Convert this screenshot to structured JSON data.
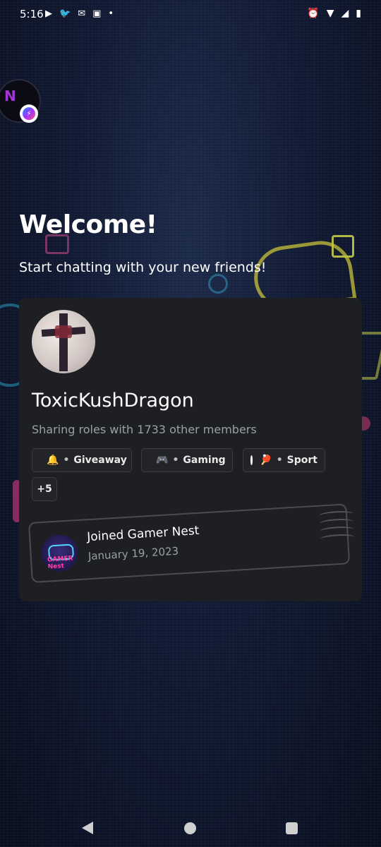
{
  "status_bar": {
    "time": "5:16",
    "left_icons": [
      "youtube-icon",
      "twitter-icon",
      "outlook-icon",
      "twitch-icon",
      "dot-icon"
    ],
    "right_icons": [
      "alarm-icon",
      "wifi-icon",
      "signal-icon",
      "battery-icon"
    ]
  },
  "chat_head": {
    "letter": "N"
  },
  "welcome": {
    "title": "Welcome!",
    "subtitle": "Start chatting with your new friends!"
  },
  "profile": {
    "username": "ToxicKushDragon",
    "sharing_text": "Sharing roles with 1733 other members",
    "roles": [
      {
        "emoji": "🔔",
        "label": "Giveaway"
      },
      {
        "emoji": "🎮",
        "label": "Gaming"
      },
      {
        "emoji": "🏓",
        "label": "Sport"
      }
    ],
    "more_roles": "+5",
    "joined": {
      "title": "Joined Gamer Nest",
      "date": "January 19, 2023",
      "server_icon_text": "GAMER Nest"
    }
  },
  "colors": {
    "card_bg": "#1e1f22",
    "muted_text": "#9aa0a8"
  }
}
